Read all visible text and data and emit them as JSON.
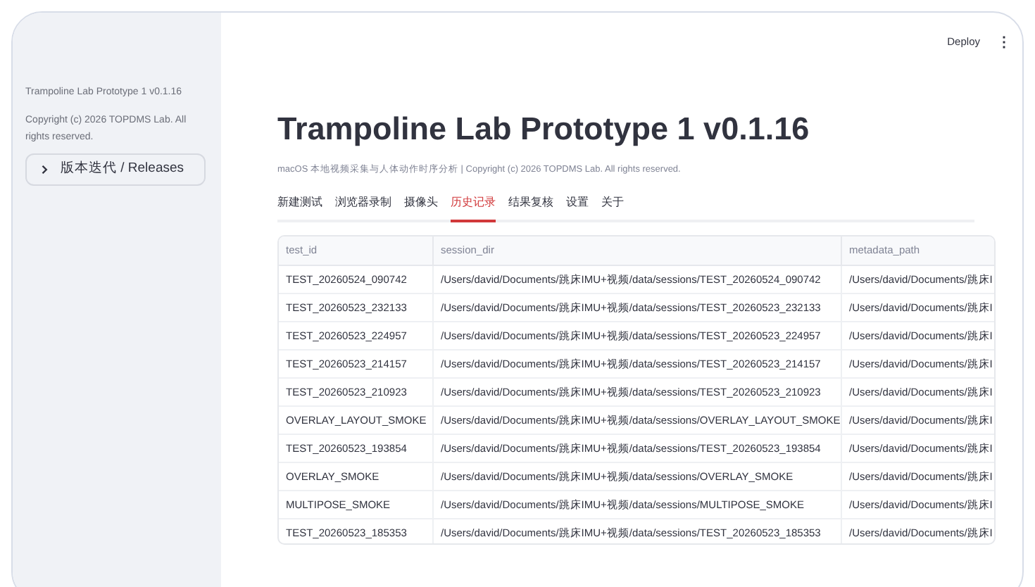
{
  "sidebar": {
    "app_name": "Trampoline Lab Prototype 1 v0.1.16",
    "copyright": "Copyright (c) 2026 TOPDMS Lab. All rights reserved.",
    "expander": {
      "label": "版本迭代 / Releases",
      "expanded": false
    }
  },
  "header": {
    "deploy": "Deploy",
    "menu": "⋮"
  },
  "title": "Trampoline Lab Prototype 1 v0.1.16",
  "subtitle": "macOS 本地视频采集与人体动作时序分析 | Copyright (c) 2026 TOPDMS Lab. All rights reserved.",
  "tabs": [
    {
      "label": "新建测试",
      "selected": false
    },
    {
      "label": "浏览器录制",
      "selected": false
    },
    {
      "label": "摄像头",
      "selected": false
    },
    {
      "label": "历史记录",
      "selected": true
    },
    {
      "label": "结果复核",
      "selected": false
    },
    {
      "label": "设置",
      "selected": false
    },
    {
      "label": "关于",
      "selected": false
    }
  ],
  "table": {
    "columns": [
      "test_id",
      "session_dir",
      "metadata_path"
    ],
    "rows": [
      [
        "TEST_20260524_090742",
        "/Users/david/Documents/跳床IMU+视频/data/sessions/TEST_20260524_090742",
        "/Users/david/Documents/跳床I"
      ],
      [
        "TEST_20260523_232133",
        "/Users/david/Documents/跳床IMU+视频/data/sessions/TEST_20260523_232133",
        "/Users/david/Documents/跳床I"
      ],
      [
        "TEST_20260523_224957",
        "/Users/david/Documents/跳床IMU+视频/data/sessions/TEST_20260523_224957",
        "/Users/david/Documents/跳床I"
      ],
      [
        "TEST_20260523_214157",
        "/Users/david/Documents/跳床IMU+视频/data/sessions/TEST_20260523_214157",
        "/Users/david/Documents/跳床I"
      ],
      [
        "TEST_20260523_210923",
        "/Users/david/Documents/跳床IMU+视频/data/sessions/TEST_20260523_210923",
        "/Users/david/Documents/跳床I"
      ],
      [
        "OVERLAY_LAYOUT_SMOKE",
        "/Users/david/Documents/跳床IMU+视频/data/sessions/OVERLAY_LAYOUT_SMOKE",
        "/Users/david/Documents/跳床I"
      ],
      [
        "TEST_20260523_193854",
        "/Users/david/Documents/跳床IMU+视频/data/sessions/TEST_20260523_193854",
        "/Users/david/Documents/跳床I"
      ],
      [
        "OVERLAY_SMOKE",
        "/Users/david/Documents/跳床IMU+视频/data/sessions/OVERLAY_SMOKE",
        "/Users/david/Documents/跳床I"
      ],
      [
        "MULTIPOSE_SMOKE",
        "/Users/david/Documents/跳床IMU+视频/data/sessions/MULTIPOSE_SMOKE",
        "/Users/david/Documents/跳床I"
      ],
      [
        "TEST_20260523_185353",
        "/Users/david/Documents/跳床IMU+视频/data/sessions/TEST_20260523_185353",
        "/Users/david/Documents/跳床I"
      ]
    ]
  }
}
